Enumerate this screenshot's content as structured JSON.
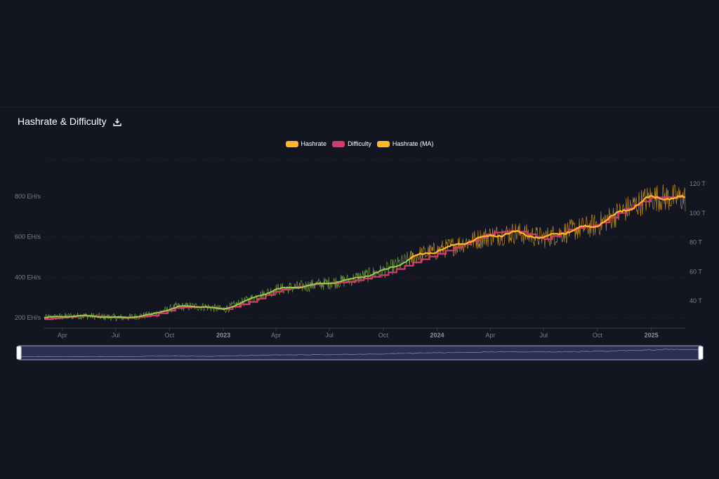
{
  "card": {
    "title": "Hashrate & Difficulty",
    "download_icon": "download-icon"
  },
  "colors": {
    "background": "#131521",
    "hashrate": "#ffb829",
    "difficulty": "#d63a6a",
    "hashrate_ma": "#ffb829",
    "early_hashrate": "#8bc34a",
    "grid": "#232634",
    "axis_text": "#7c7f8c"
  },
  "chart_data": {
    "type": "line",
    "x_range": [
      "2022-03-01",
      "2025-02-28"
    ],
    "x_ticks": [
      {
        "label": "Apr",
        "date": "2022-04-01",
        "bold": false
      },
      {
        "label": "Jul",
        "date": "2022-07-01",
        "bold": false
      },
      {
        "label": "Oct",
        "date": "2022-10-01",
        "bold": false
      },
      {
        "label": "2023",
        "date": "2023-01-01",
        "bold": true
      },
      {
        "label": "Apr",
        "date": "2023-04-01",
        "bold": false
      },
      {
        "label": "Jul",
        "date": "2023-07-01",
        "bold": false
      },
      {
        "label": "Oct",
        "date": "2023-10-01",
        "bold": false
      },
      {
        "label": "2024",
        "date": "2024-01-01",
        "bold": true
      },
      {
        "label": "Apr",
        "date": "2024-04-01",
        "bold": false
      },
      {
        "label": "Jul",
        "date": "2024-07-01",
        "bold": false
      },
      {
        "label": "Oct",
        "date": "2024-10-01",
        "bold": false
      },
      {
        "label": "2025",
        "date": "2025-01-01",
        "bold": true
      }
    ],
    "y_left": {
      "ticks": [
        200,
        400,
        600,
        800
      ],
      "labels": [
        "200 EH/s",
        "400 EH/s",
        "600 EH/s",
        "800 EH/s"
      ],
      "range": [
        160,
        1000
      ]
    },
    "y_right": {
      "ticks": [
        40,
        60,
        80,
        100,
        120
      ],
      "labels": [
        "40 T",
        "60 T",
        "80 T",
        "100 T",
        "120 T"
      ],
      "range": [
        20,
        140
      ]
    },
    "legend_position": "top-center",
    "grid": true,
    "series": [
      {
        "name": "Hashrate",
        "axis": "left",
        "points": [
          [
            "2022-03-01",
            200
          ],
          [
            "2022-05-01",
            210
          ],
          [
            "2022-07-15",
            200
          ],
          [
            "2022-09-01",
            215
          ],
          [
            "2022-10-15",
            255
          ],
          [
            "2022-12-01",
            255
          ],
          [
            "2023-01-01",
            240
          ],
          [
            "2023-02-15",
            290
          ],
          [
            "2023-04-01",
            340
          ],
          [
            "2023-06-01",
            360
          ],
          [
            "2023-08-01",
            385
          ],
          [
            "2023-10-01",
            430
          ],
          [
            "2023-12-01",
            510
          ],
          [
            "2024-01-01",
            530
          ],
          [
            "2024-02-15",
            570
          ],
          [
            "2024-04-01",
            605
          ],
          [
            "2024-05-15",
            620
          ],
          [
            "2024-07-01",
            595
          ],
          [
            "2024-08-15",
            630
          ],
          [
            "2024-10-01",
            660
          ],
          [
            "2024-11-15",
            730
          ],
          [
            "2025-01-01",
            795
          ],
          [
            "2025-02-28",
            790
          ]
        ]
      },
      {
        "name": "Difficulty",
        "axis": "right",
        "points": [
          [
            "2022-03-01",
            27.5
          ],
          [
            "2022-05-01",
            29.8
          ],
          [
            "2022-07-15",
            28.2
          ],
          [
            "2022-09-01",
            30.0
          ],
          [
            "2022-10-15",
            35.6
          ],
          [
            "2022-12-01",
            35.8
          ],
          [
            "2023-01-01",
            34.1
          ],
          [
            "2023-02-15",
            39.4
          ],
          [
            "2023-04-01",
            47.0
          ],
          [
            "2023-06-01",
            51.2
          ],
          [
            "2023-08-01",
            53.0
          ],
          [
            "2023-10-01",
            58.0
          ],
          [
            "2023-12-01",
            67.9
          ],
          [
            "2024-01-01",
            72.0
          ],
          [
            "2024-02-15",
            79.0
          ],
          [
            "2024-04-01",
            86.4
          ],
          [
            "2024-05-15",
            88.0
          ],
          [
            "2024-07-01",
            82.0
          ],
          [
            "2024-08-15",
            89.0
          ],
          [
            "2024-10-01",
            92.0
          ],
          [
            "2024-11-15",
            102.3
          ],
          [
            "2025-01-01",
            110.5
          ],
          [
            "2025-02-28",
            111.0
          ]
        ]
      },
      {
        "name": "Hashrate (MA)",
        "axis": "left",
        "points": [
          [
            "2022-03-01",
            200
          ],
          [
            "2022-05-01",
            210
          ],
          [
            "2022-07-15",
            200
          ],
          [
            "2022-09-01",
            215
          ],
          [
            "2022-10-15",
            255
          ],
          [
            "2022-12-01",
            255
          ],
          [
            "2023-01-01",
            240
          ],
          [
            "2023-02-15",
            290
          ],
          [
            "2023-04-01",
            340
          ],
          [
            "2023-06-01",
            360
          ],
          [
            "2023-08-01",
            385
          ],
          [
            "2023-10-01",
            430
          ],
          [
            "2023-12-01",
            510
          ],
          [
            "2024-01-01",
            530
          ],
          [
            "2024-02-15",
            570
          ],
          [
            "2024-04-01",
            605
          ],
          [
            "2024-05-15",
            620
          ],
          [
            "2024-07-01",
            595
          ],
          [
            "2024-08-15",
            630
          ],
          [
            "2024-10-01",
            660
          ],
          [
            "2024-11-15",
            730
          ],
          [
            "2025-01-01",
            795
          ],
          [
            "2025-02-28",
            790
          ]
        ]
      }
    ]
  },
  "navigator": {
    "range": [
      "2022-03-01",
      "2025-02-28"
    ]
  }
}
